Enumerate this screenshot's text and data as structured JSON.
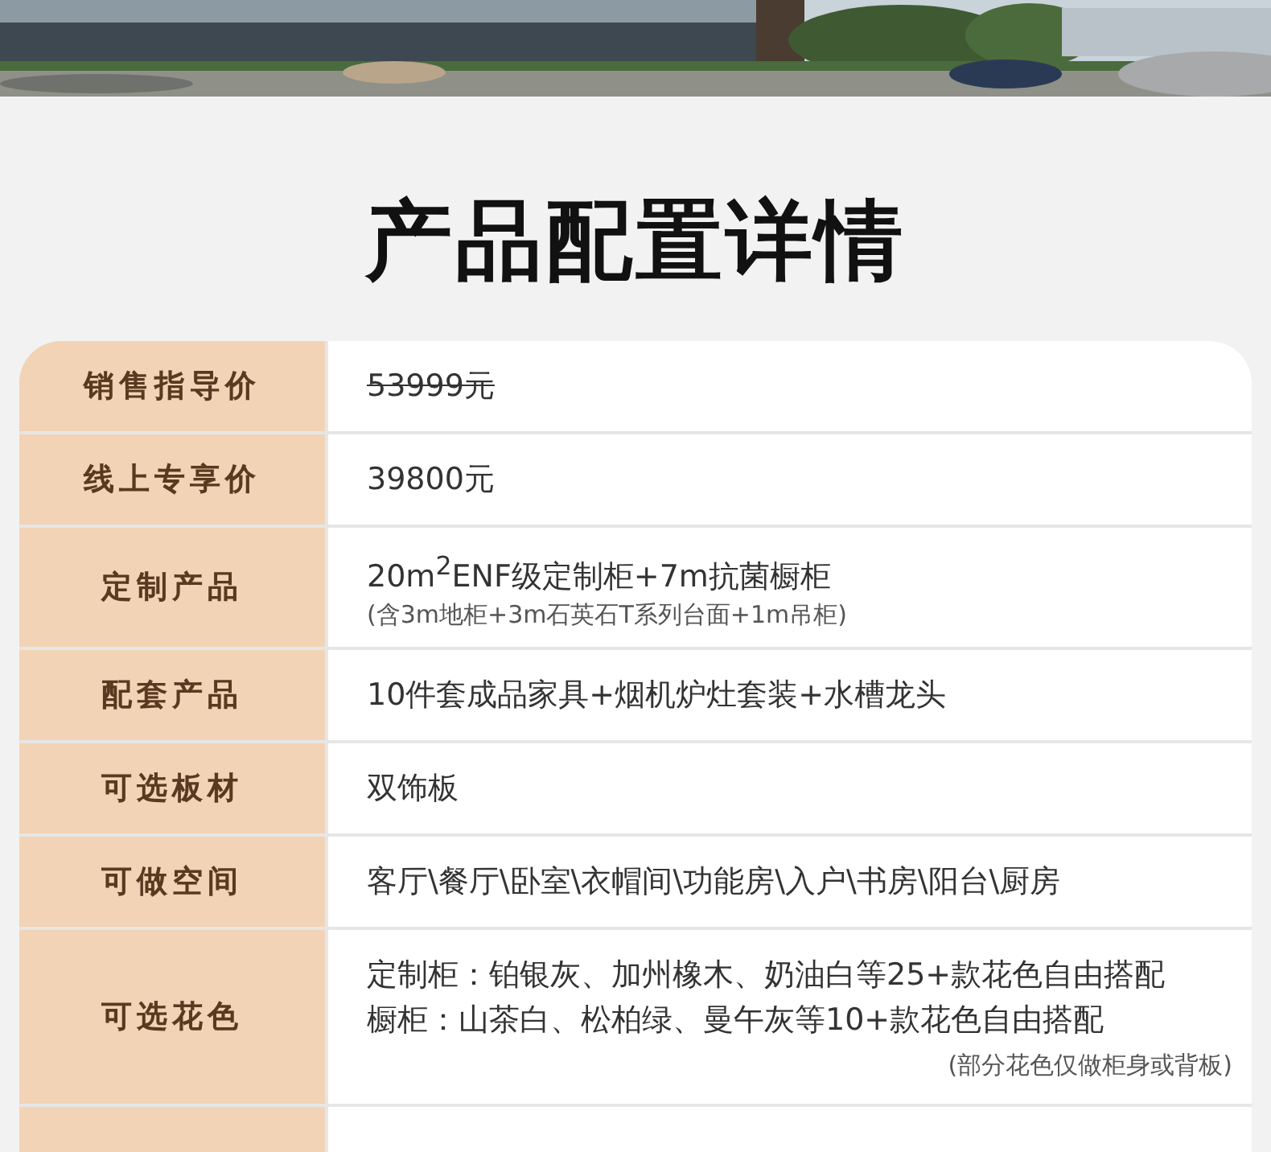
{
  "title": "产品配置详情",
  "rows": [
    {
      "label": "销售指导价",
      "lines": [
        "53999元"
      ],
      "struck": true
    },
    {
      "label": "线上专享价",
      "lines": [
        "39800元"
      ],
      "struck": false
    },
    {
      "label": "定制产品",
      "lines": [
        "20m$^{2}$ENF级定制柜+7m抗菌橱柜"
      ],
      "note": "(含3m地柜+3m石英石T系列台面+1m吊柜)",
      "struck": false
    },
    {
      "label": "配套产品",
      "lines": [
        "10件套成品家具+烟机炉灶套装+水槽龙头"
      ],
      "struck": false
    },
    {
      "label": "可选板材",
      "lines": [
        "双饰板"
      ],
      "struck": false
    },
    {
      "label": "可做空间",
      "lines": [
        "客厅\\餐厅\\卧室\\衣帽间\\功能房\\入户\\书房\\阳台\\厨房"
      ],
      "struck": false
    },
    {
      "label": "可选花色",
      "lines": [
        "定制柜：铂银灰、加州橡木、奶油白等25+款花色自由搭配",
        "橱柜：山茶白、松柏绿、曼午灰等10+款花色自由搭配"
      ],
      "note": "(部分花色仅做柜身或背板)",
      "struck": false
    }
  ]
}
